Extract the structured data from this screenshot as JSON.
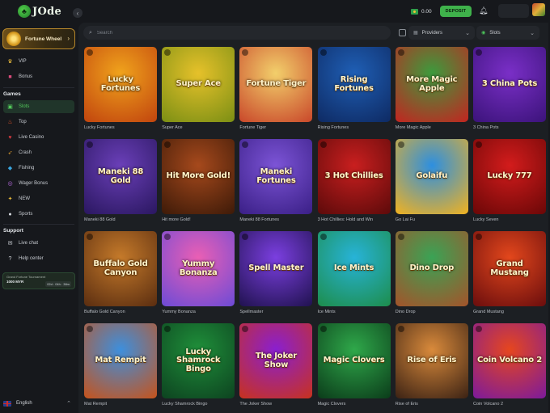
{
  "brand": {
    "logo_text": "JOde"
  },
  "header": {
    "balance": "0.00",
    "deposit_label": "DEPOSIT",
    "icons": {
      "currency_flag": "currency-flag-icon",
      "bell": "bell-icon",
      "avatar": "avatar"
    }
  },
  "sidebar": {
    "fortune_wheel": "Fortune Wheel",
    "top_items": [
      {
        "label": "VIP",
        "icon": "crown-icon"
      },
      {
        "label": "Bonus",
        "icon": "gift-icon"
      }
    ],
    "games_title": "Games",
    "game_items": [
      {
        "label": "Slots",
        "icon": "slots-icon",
        "active": true
      },
      {
        "label": "Top",
        "icon": "fire-icon"
      },
      {
        "label": "Live Casino",
        "icon": "live-casino-icon"
      },
      {
        "label": "Crash",
        "icon": "crash-icon"
      },
      {
        "label": "Fishing",
        "icon": "fish-icon"
      },
      {
        "label": "Wager Bonus",
        "icon": "wager-bonus-icon"
      },
      {
        "label": "NEW",
        "icon": "new-icon"
      },
      {
        "label": "Sports",
        "icon": "sports-icon"
      }
    ],
    "support_title": "Support",
    "support_items": [
      {
        "label": "Live chat",
        "icon": "chat-icon"
      },
      {
        "label": "Help center",
        "icon": "help-icon"
      }
    ],
    "tournament": {
      "title": "Grand Fortune Tournament",
      "prize": "1000 MYR",
      "timer": "02d : 04h : 38m"
    },
    "language": "English"
  },
  "filters": {
    "search_placeholder": "Search",
    "providers_label": "Providers",
    "category_label": "Slots"
  },
  "games": [
    {
      "name": "Lucky Fortunes",
      "art": "Lucky Fortunes",
      "bg": [
        "#f0a31c",
        "#c1440e"
      ]
    },
    {
      "name": "Super Ace",
      "art": "Super Ace",
      "bg": [
        "#e6c12a",
        "#7b8f14"
      ]
    },
    {
      "name": "Fortune Tiger",
      "art": "Fortune Tiger",
      "bg": [
        "#f2cf6b",
        "#c9472a"
      ]
    },
    {
      "name": "Rising Fortunes",
      "art": "Rising Fortunes",
      "bg": [
        "#1f5fb5",
        "#0e2a63"
      ]
    },
    {
      "name": "More Magic Apple",
      "art": "More Magic Apple",
      "bg": [
        "#3c9b3d",
        "#c32420"
      ]
    },
    {
      "name": "3 China Pots",
      "art": "3 China Pots",
      "bg": [
        "#7a2fc7",
        "#3b137a"
      ]
    },
    {
      "name": "Maneki 88 Gold",
      "art": "Maneki 88 Gold",
      "bg": [
        "#6a3fb8",
        "#2a1760"
      ]
    },
    {
      "name": "Hit more Gold!",
      "art": "Hit More Gold!",
      "bg": [
        "#a6491c",
        "#3d1a08"
      ]
    },
    {
      "name": "Maneki 88 Fortunes",
      "art": "Maneki Fortunes",
      "bg": [
        "#7c54d6",
        "#3a1f86"
      ]
    },
    {
      "name": "3 Hot Chillies: Hold and Win",
      "art": "3 Hot Chillies",
      "bg": [
        "#c91f1f",
        "#5c0a0a"
      ]
    },
    {
      "name": "Go Lai Fu",
      "art": "Golaifu",
      "bg": [
        "#2d8fe0",
        "#f2b21f"
      ]
    },
    {
      "name": "Lucky Seven",
      "art": "Lucky 777",
      "bg": [
        "#d31c1c",
        "#6a0707"
      ]
    },
    {
      "name": "Buffalo Gold Canyon",
      "art": "Buffalo Gold Canyon",
      "bg": [
        "#c57a2a",
        "#5a2d10"
      ]
    },
    {
      "name": "Yummy Bonanza",
      "art": "Yummy Bonanza",
      "bg": [
        "#ea5fb4",
        "#6c4bd6"
      ]
    },
    {
      "name": "Spellmaster",
      "art": "Spell Master",
      "bg": [
        "#7b3fe0",
        "#20124f"
      ]
    },
    {
      "name": "Ice Mints",
      "art": "Ice Mints",
      "bg": [
        "#27b3d8",
        "#1d8d4b"
      ]
    },
    {
      "name": "Dino Drop",
      "art": "Dino Drop",
      "bg": [
        "#3aa355",
        "#a4532a"
      ]
    },
    {
      "name": "Grand Mustang",
      "art": "Grand Mustang",
      "bg": [
        "#e3471c",
        "#6a0d0d"
      ]
    },
    {
      "name": "Mat Rempit",
      "art": "Mat Rempit",
      "bg": [
        "#3d8fdd",
        "#c6531b"
      ]
    },
    {
      "name": "Lucky Shamrock Bingo",
      "art": "Lucky Shamrock Bingo",
      "bg": [
        "#1f8f3a",
        "#0d4320"
      ]
    },
    {
      "name": "The Joker Show",
      "art": "The Joker Show",
      "bg": [
        "#8a1fd0",
        "#c8321d"
      ]
    },
    {
      "name": "Magic Clovers",
      "art": "Magic Clovers",
      "bg": [
        "#2fa84a",
        "#0b3c1a"
      ]
    },
    {
      "name": "Rise of Eris",
      "art": "Rise of Eris",
      "bg": [
        "#d98a3b",
        "#3b2214"
      ]
    },
    {
      "name": "Coin Volcano 2",
      "art": "Coin Volcano 2",
      "bg": [
        "#e6461e",
        "#7c1a9c"
      ]
    }
  ]
}
